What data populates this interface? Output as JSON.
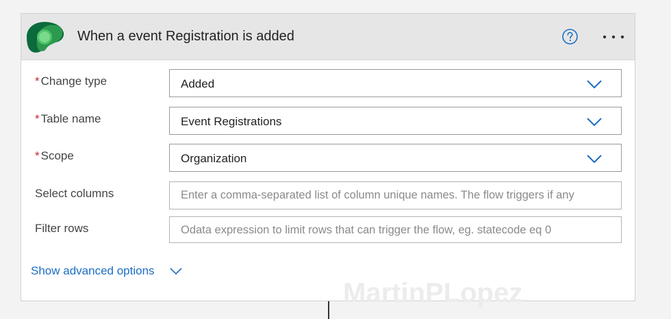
{
  "trigger": {
    "title": "When a event Registration is added",
    "logo_icon": "dataverse-logo-icon",
    "help_icon": "question-circle-icon",
    "more_icon": "ellipsis-icon"
  },
  "fields": {
    "change_type": {
      "required_mark": "*",
      "label": "Change type",
      "value": "Added"
    },
    "table_name": {
      "required_mark": "*",
      "label": "Table name",
      "value": "Event Registrations"
    },
    "scope": {
      "required_mark": "*",
      "label": "Scope",
      "value": "Organization"
    },
    "select_columns": {
      "label": "Select columns",
      "placeholder": "Enter a comma-separated list of column unique names. The flow triggers if any"
    },
    "filter_rows": {
      "label": "Filter rows",
      "placeholder": "Odata expression to limit rows that can trigger the flow, eg. statecode eq 0"
    }
  },
  "advanced": {
    "label": "Show advanced options"
  },
  "watermark": "MartinPLopez",
  "colors": {
    "accent": "#1b6ec2",
    "required": "#c4262e",
    "header_bg": "#e6e6e6",
    "logo_dark": "#0b6a3b",
    "logo_light": "#4fc36a"
  }
}
